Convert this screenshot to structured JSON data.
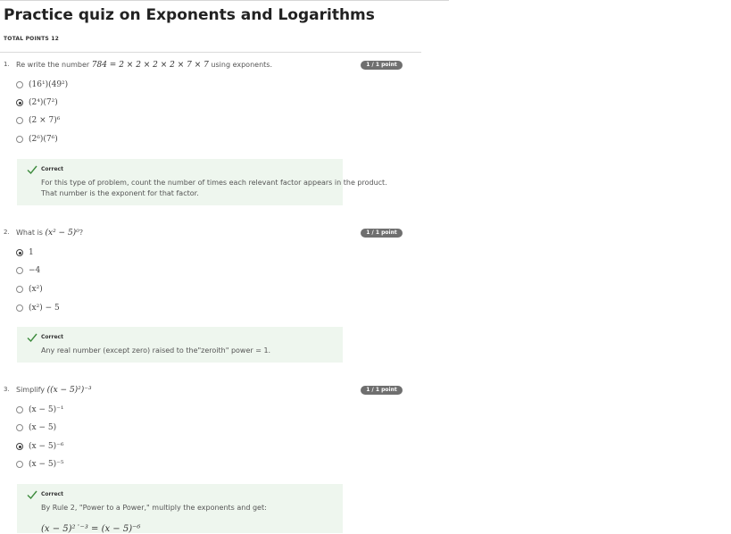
{
  "page": {
    "title": "Practice quiz on Exponents and Logarithms",
    "total_points": "TOTAL POINTS 12"
  },
  "questions": [
    {
      "number": "1.",
      "text_prefix": "Re write the number ",
      "math": "784 = 2 × 2 × 2 × 2 × 7 × 7",
      "text_suffix": " using exponents.",
      "score": "1 / 1 point",
      "options": [
        {
          "label": "(16¹)(49²)",
          "selected": false
        },
        {
          "label": "(2⁴)(7²)",
          "selected": true
        },
        {
          "label": "(2 × 7)⁶",
          "selected": false
        },
        {
          "label": "(2⁶)(7⁶)",
          "selected": false
        }
      ],
      "feedback": {
        "status": "Correct",
        "lines": [
          "For this type of problem, count the number of times each relevant factor appears in the product.",
          "That number is the exponent for that factor."
        ]
      }
    },
    {
      "number": "2.",
      "text_prefix": "What is ",
      "math": "(x² − 5)⁰",
      "text_suffix": "?",
      "score": "1 / 1 point",
      "options": [
        {
          "label": "1",
          "selected": true
        },
        {
          "label": "−4",
          "selected": false
        },
        {
          "label": "(x²)",
          "selected": false
        },
        {
          "label": "(x²) − 5",
          "selected": false
        }
      ],
      "feedback": {
        "status": "Correct",
        "lines": [
          "Any real number (except zero) raised to the\"zeroith\" power = 1."
        ]
      }
    },
    {
      "number": "3.",
      "text_prefix": "Simplify ",
      "math": "((x − 5)²)⁻³",
      "text_suffix": "",
      "score": "1 / 1 point",
      "options": [
        {
          "label": "(x − 5)⁻¹",
          "selected": false
        },
        {
          "label": "(x − 5)",
          "selected": false
        },
        {
          "label": "(x − 5)⁻⁶",
          "selected": true
        },
        {
          "label": "(x − 5)⁻⁵",
          "selected": false
        }
      ],
      "feedback": {
        "status": "Correct",
        "lines": [
          "By Rule 2, \"Power to a Power,\" multiply the exponents and get:"
        ],
        "math_line": "(x − 5)²˙⁻³ = (x − 5)⁻⁶"
      }
    }
  ],
  "colors": {
    "badge_bg": "#6f6f6f",
    "feedback_bg": "#eef6ee",
    "check_green": "#3c8a3c"
  }
}
